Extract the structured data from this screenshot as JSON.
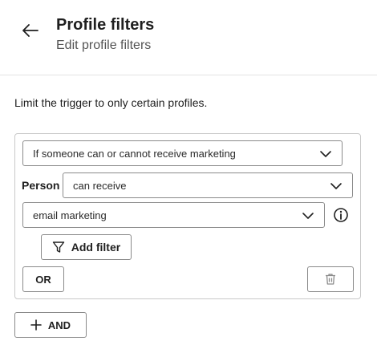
{
  "header": {
    "title": "Profile filters",
    "subtitle": "Edit profile filters"
  },
  "description": "Limit the trigger to only certain profiles.",
  "condition": {
    "type_select": "If someone can or cannot receive marketing",
    "person_label": "Person",
    "ability_select": "can receive",
    "channel_select": "email marketing"
  },
  "buttons": {
    "add_filter": "Add filter",
    "or": "OR",
    "and": "AND"
  },
  "icons": [
    "arrow-left-icon",
    "chevron-down-icon",
    "info-icon",
    "filter-icon",
    "trash-icon",
    "plus-icon"
  ]
}
